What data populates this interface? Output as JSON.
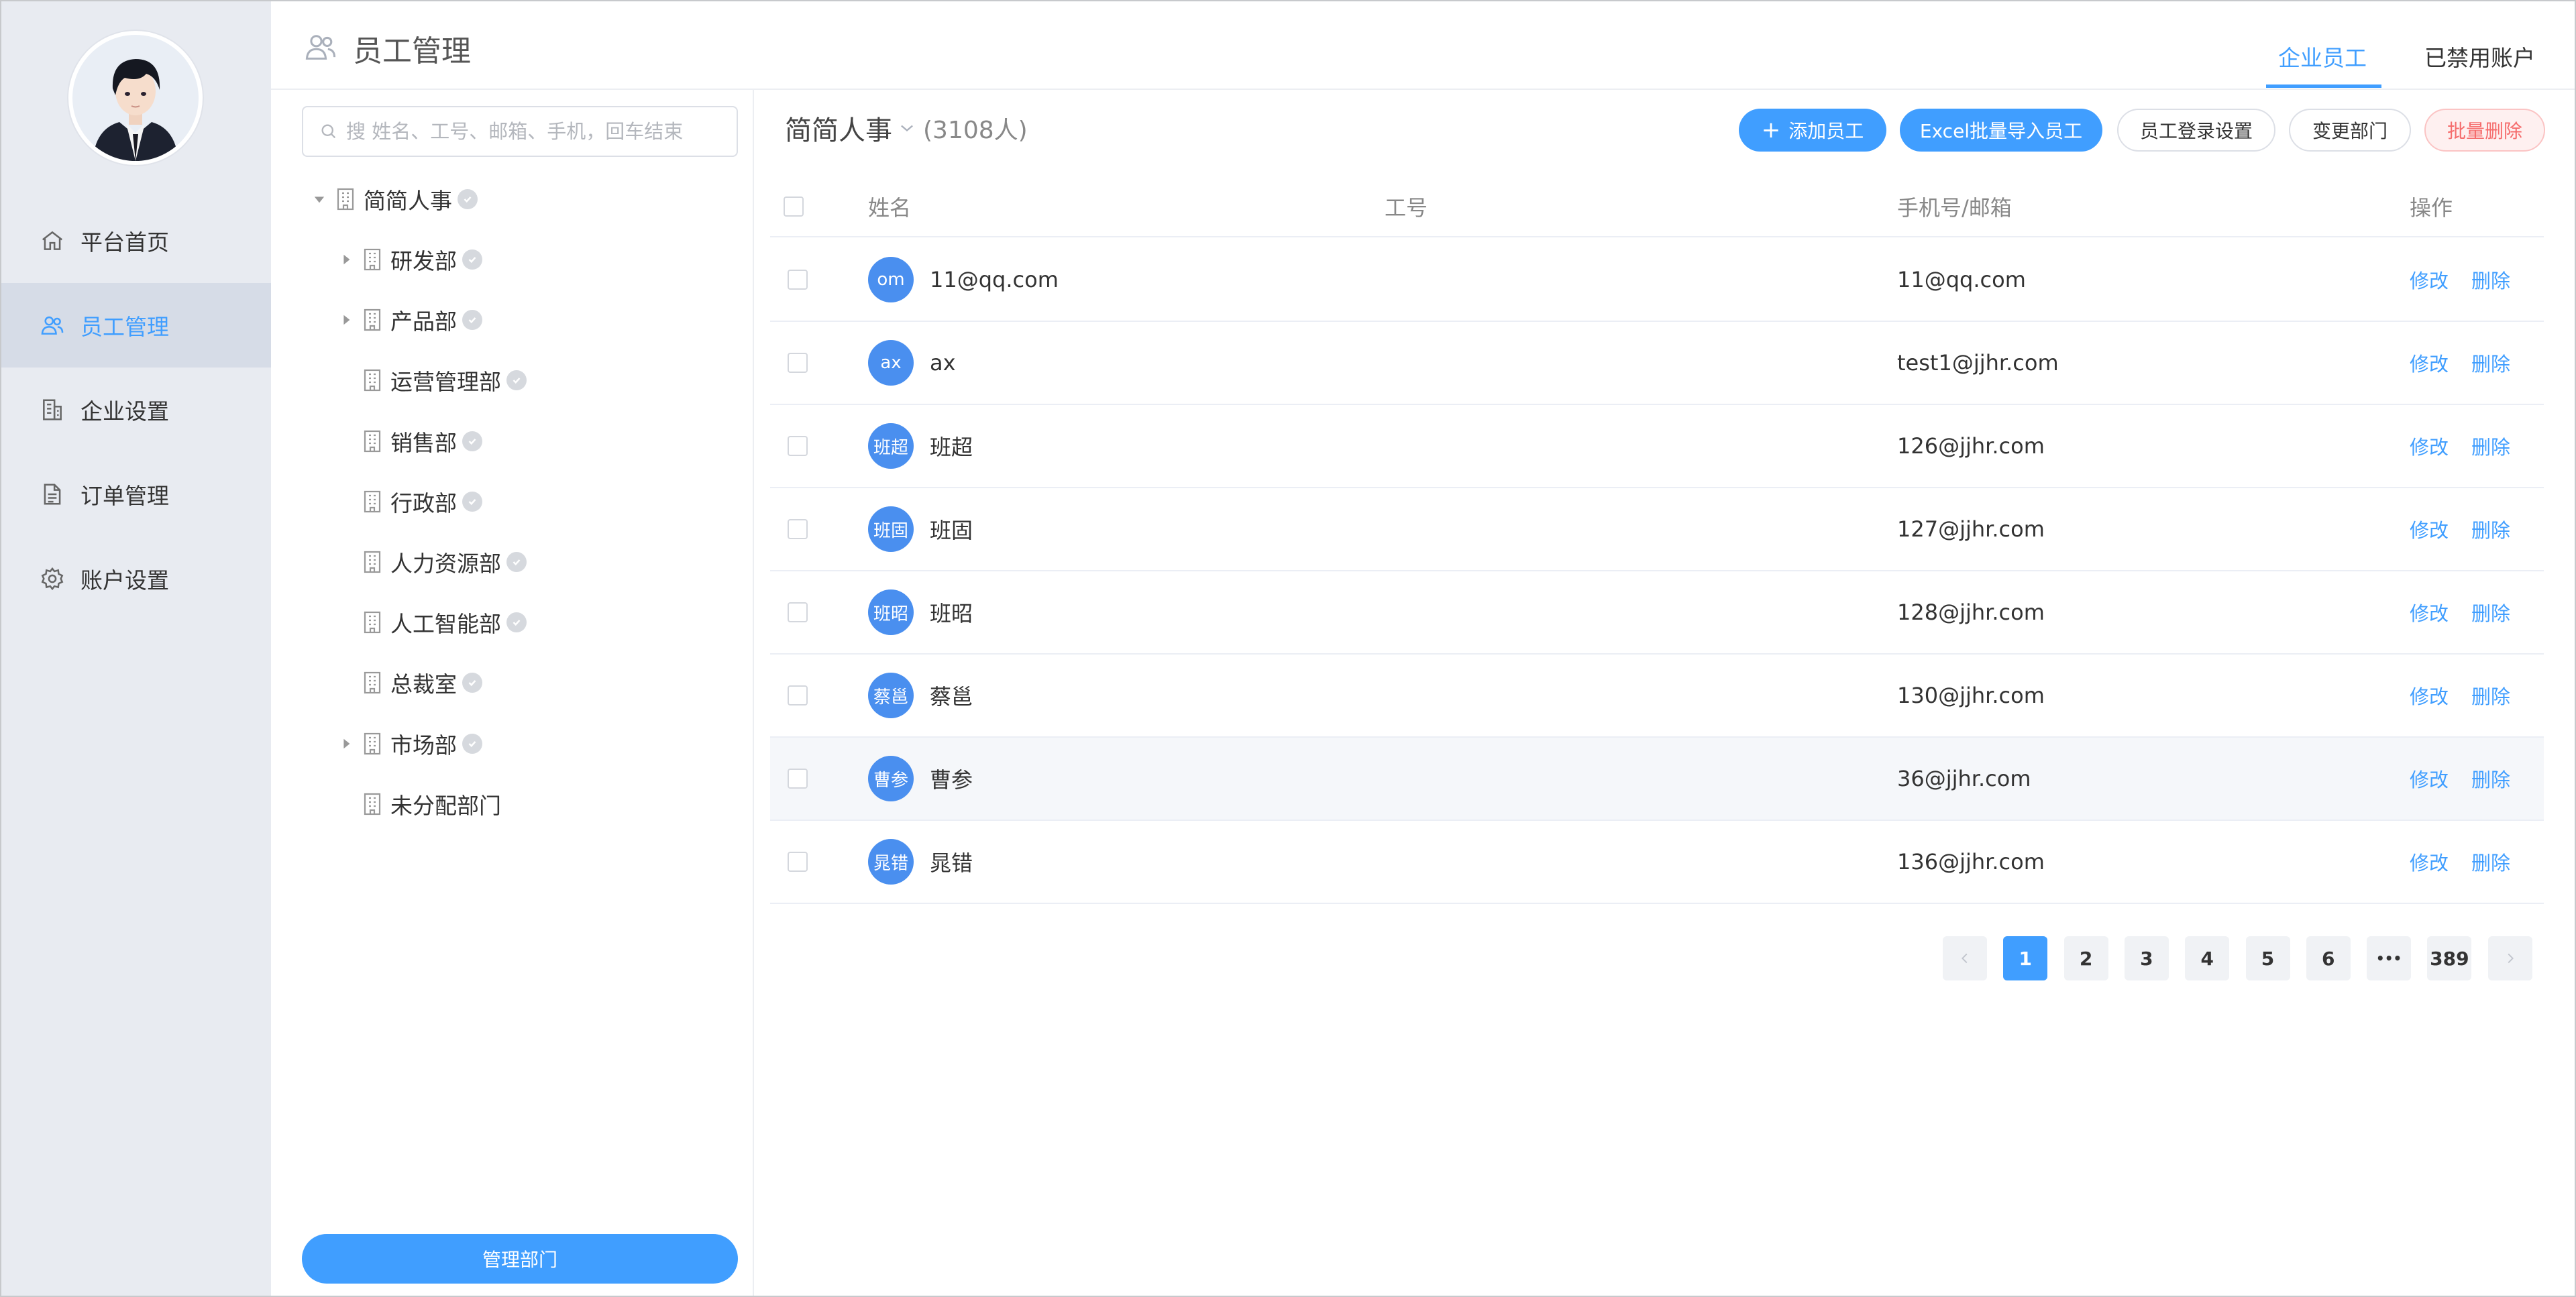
{
  "nav": {
    "items": [
      {
        "label": "平台首页",
        "icon": "home-icon"
      },
      {
        "label": "员工管理",
        "icon": "users-icon",
        "active": true
      },
      {
        "label": "企业设置",
        "icon": "building-icon"
      },
      {
        "label": "订单管理",
        "icon": "document-icon"
      },
      {
        "label": "账户设置",
        "icon": "gear-icon"
      }
    ]
  },
  "header": {
    "title": "员工管理",
    "tabs": [
      {
        "label": "企业员工",
        "active": true
      },
      {
        "label": "已禁用账户",
        "active": false
      }
    ]
  },
  "dept_panel": {
    "search_placeholder": "搜 姓名、工号、邮箱、手机，回车结束",
    "root": "简简人事",
    "departments": [
      {
        "label": "研发部",
        "expandable": true,
        "checked": true
      },
      {
        "label": "产品部",
        "expandable": true,
        "checked": true
      },
      {
        "label": "运营管理部",
        "expandable": false,
        "checked": true
      },
      {
        "label": "销售部",
        "expandable": false,
        "checked": true
      },
      {
        "label": "行政部",
        "expandable": false,
        "checked": true
      },
      {
        "label": "人力资源部",
        "expandable": false,
        "checked": true
      },
      {
        "label": "人工智能部",
        "expandable": false,
        "checked": true
      },
      {
        "label": "总裁室",
        "expandable": false,
        "checked": true
      },
      {
        "label": "市场部",
        "expandable": true,
        "checked": true
      },
      {
        "label": "未分配部门",
        "expandable": false,
        "checked": false
      }
    ],
    "manage_button": "管理部门"
  },
  "main": {
    "dept_name": "简简人事",
    "count": "(3108人)",
    "buttons": {
      "add": "添加员工",
      "import": "Excel批量导入员工",
      "login_settings": "员工登录设置",
      "change_dept": "变更部门",
      "batch_delete": "批量删除"
    },
    "columns": {
      "name": "姓名",
      "id": "工号",
      "contact": "手机号/邮箱",
      "ops": "操作"
    },
    "rows": [
      {
        "avatar": "om",
        "name": "11@qq.com",
        "id": "",
        "contact": "11@qq.com",
        "edit": "修改",
        "delete": "删除"
      },
      {
        "avatar": "ax",
        "name": "ax",
        "id": "",
        "contact": "test1@jjhr.com",
        "edit": "修改",
        "delete": "删除"
      },
      {
        "avatar": "班超",
        "name": "班超",
        "id": "",
        "contact": "126@jjhr.com",
        "edit": "修改",
        "delete": "删除"
      },
      {
        "avatar": "班固",
        "name": "班固",
        "id": "",
        "contact": "127@jjhr.com",
        "edit": "修改",
        "delete": "删除"
      },
      {
        "avatar": "班昭",
        "name": "班昭",
        "id": "",
        "contact": "128@jjhr.com",
        "edit": "修改",
        "delete": "删除"
      },
      {
        "avatar": "蔡邕",
        "name": "蔡邕",
        "id": "",
        "contact": "130@jjhr.com",
        "edit": "修改",
        "delete": "删除"
      },
      {
        "avatar": "曹参",
        "name": "曹参",
        "id": "",
        "contact": "36@jjhr.com",
        "edit": "修改",
        "delete": "删除"
      },
      {
        "avatar": "晁错",
        "name": "晁错",
        "id": "",
        "contact": "136@jjhr.com",
        "edit": "修改",
        "delete": "删除"
      }
    ]
  },
  "pagination": {
    "pages": [
      "1",
      "2",
      "3",
      "4",
      "5",
      "6"
    ],
    "ellipsis": "•••",
    "last": "389",
    "current": "1"
  },
  "colors": {
    "accent": "#409eff",
    "danger": "#f56c6c",
    "nav_bg": "#e8ebf1",
    "avatar_bg": "#4a8fef"
  }
}
